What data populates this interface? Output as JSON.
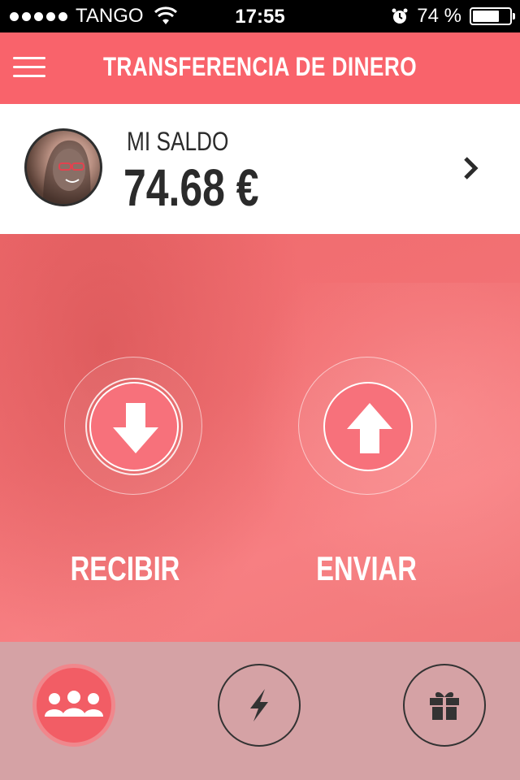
{
  "status_bar": {
    "carrier": "TANGO",
    "time": "17:55",
    "battery_text": "74 %",
    "battery_level": 0.74
  },
  "header": {
    "title": "TRANSFERENCIA DE DINERO",
    "menu_icon": "hamburger-menu-icon"
  },
  "balance": {
    "label": "MI SALDO",
    "amount": "74.68 €",
    "chevron_icon": "chevron-right-icon"
  },
  "actions": [
    {
      "label": "RECIBIR",
      "icon": "arrow-down-icon"
    },
    {
      "label": "ENVIAR",
      "icon": "arrow-up-icon"
    }
  ],
  "tab_bar": [
    {
      "icon": "group-icon",
      "active": true
    },
    {
      "icon": "lightning-icon",
      "active": false
    },
    {
      "icon": "gift-icon",
      "active": false
    }
  ],
  "colors": {
    "primary": "#f9636b",
    "hero": "#f27174",
    "bottom_bar": "#d5a2a5",
    "dark": "#2b2b2b"
  }
}
